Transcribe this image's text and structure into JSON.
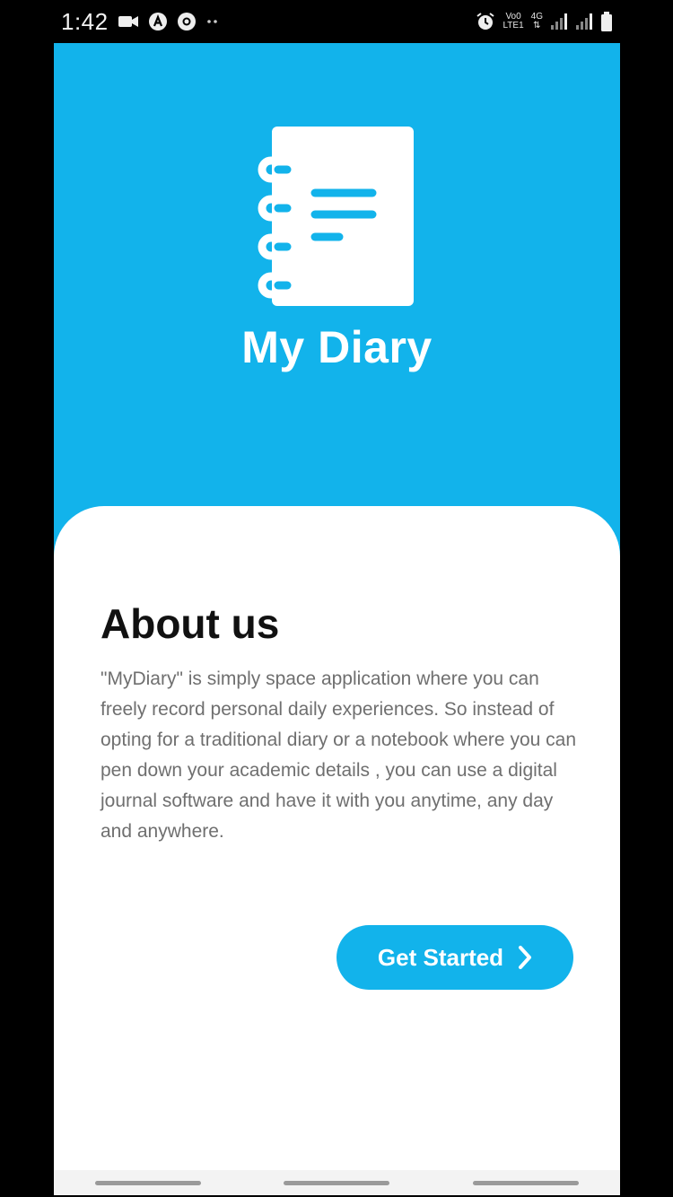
{
  "status_bar": {
    "time": "1:42",
    "network_top": "Vo0",
    "network_bottom": "LTE1",
    "gen_top": "4G",
    "gen_bottom": "⇅",
    "icons": [
      "video-record-icon",
      "a-badge-icon",
      "chrome-icon",
      "more-dots-icon",
      "alarm-icon",
      "signal-icon",
      "signal-icon",
      "battery-icon"
    ]
  },
  "app": {
    "title": "My Diary",
    "logo_icon": "notebook-icon"
  },
  "about": {
    "heading": "About us",
    "body": " \"MyDiary\" is simply space application where you can freely record personal daily experiences. So instead of opting for a traditional diary or a notebook where you can pen down your academic details , you can use a digital journal software and have it with you anytime, any day and anywhere."
  },
  "cta": {
    "label": "Get Started",
    "icon": "chevron-right-icon"
  },
  "colors": {
    "primary": "#12b3eb",
    "card": "#ffffff",
    "heading": "#111111",
    "body_text": "#6f6f6f"
  }
}
